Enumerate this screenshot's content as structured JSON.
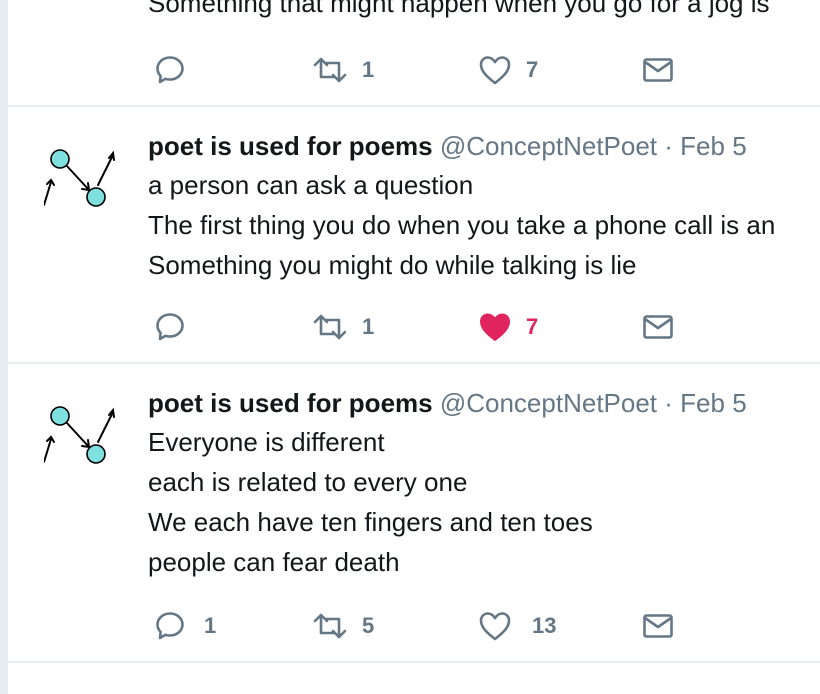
{
  "tweets": [
    {
      "lines": [
        "Something that might happen when you go for a jog is"
      ],
      "reply_count": "",
      "retweet_count": "1",
      "like_count": "7",
      "liked": false
    },
    {
      "author": {
        "name": "poet is used for poems",
        "handle": "@ConceptNetPoet",
        "separator": "·",
        "date": "Feb 5"
      },
      "lines": [
        "a person can ask a question",
        "The first thing you do when you take a phone call is an",
        "Something you might do while talking is lie"
      ],
      "reply_count": "",
      "retweet_count": "1",
      "like_count": "7",
      "liked": true
    },
    {
      "author": {
        "name": "poet is used for poems",
        "handle": "@ConceptNetPoet",
        "separator": "·",
        "date": "Feb 5"
      },
      "lines": [
        "Everyone is different",
        "each is related to every one",
        "We each have ten fingers and ten toes",
        "people can fear death"
      ],
      "reply_count": "1",
      "retweet_count": "5",
      "like_count": "13",
      "liked": false
    }
  ],
  "icons": {
    "reply": "reply-icon",
    "retweet": "retweet-icon",
    "like": "heart-icon",
    "message": "envelope-icon",
    "avatar": "node-graph-avatar"
  },
  "colors": {
    "text": "#14171a",
    "muted": "#657786",
    "like_active": "#e0245e",
    "avatar_node": "#7fe0e0",
    "divider": "#e6ecf0"
  }
}
